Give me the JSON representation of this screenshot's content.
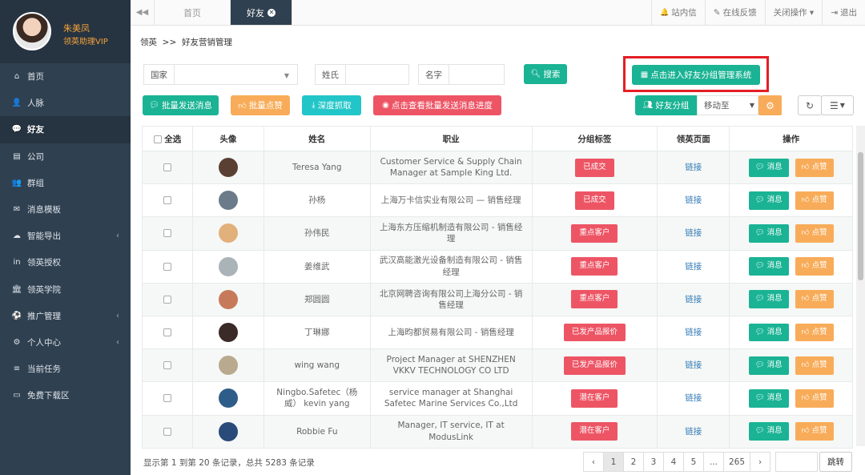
{
  "profile": {
    "name": "朱美凤",
    "role": "领英助理VIP"
  },
  "sidebar": {
    "items": [
      {
        "label": "首页",
        "icon": "home-icon",
        "glyph": "⌂"
      },
      {
        "label": "人脉",
        "icon": "user-icon",
        "glyph": "👤"
      },
      {
        "label": "好友",
        "icon": "comments-icon",
        "glyph": "💬",
        "active": true
      },
      {
        "label": "公司",
        "icon": "briefcase-icon",
        "glyph": "▤"
      },
      {
        "label": "群组",
        "icon": "users-icon",
        "glyph": "👥"
      },
      {
        "label": "消息模板",
        "icon": "envelope-icon",
        "glyph": "✉"
      },
      {
        "label": "智能导出",
        "icon": "cloud-download-icon",
        "glyph": "☁",
        "arrow": "‹"
      },
      {
        "label": "领英授权",
        "icon": "linkedin-icon",
        "glyph": "in"
      },
      {
        "label": "领英学院",
        "icon": "bank-icon",
        "glyph": "🏛"
      },
      {
        "label": "推广管理",
        "icon": "soccer-icon",
        "glyph": "⚽",
        "arrow": "‹"
      },
      {
        "label": "个人中心",
        "icon": "cog-icon",
        "glyph": "⚙",
        "arrow": "‹"
      },
      {
        "label": "当前任务",
        "icon": "tasks-icon",
        "glyph": "≡"
      },
      {
        "label": "免费下载区",
        "icon": "credit-card-icon",
        "glyph": "▭"
      }
    ]
  },
  "topbar": {
    "tabs": [
      {
        "label": "首页"
      },
      {
        "label": "好友"
      }
    ],
    "links": [
      {
        "label": "站内信",
        "glyph": "🔔"
      },
      {
        "label": "在线反馈",
        "glyph": "✎"
      },
      {
        "label": "关闭操作 ▾"
      },
      {
        "label": "退出",
        "glyph": "⇥"
      }
    ]
  },
  "breadcrumb": "领英  >>  好友营销管理",
  "filters": {
    "country_label": "国家",
    "surname_label": "姓氏",
    "name_label": "名字",
    "search_label": "搜索"
  },
  "actions": {
    "enter_group_system": "点击进入好友分组管理系统",
    "batch_send": "批量发送消息",
    "batch_like": "批量点赞",
    "deep_crawl": "深度抓取",
    "view_progress": "点击查看批量发送消息进度",
    "friend_group": "好友分组",
    "move_to": "移动至"
  },
  "table": {
    "headers": {
      "select_all": "全选",
      "avatar": "头像",
      "name": "姓名",
      "job": "职业",
      "group_tag": "分组标签",
      "linkedin_page": "领英页面",
      "ops": "操作"
    },
    "link_label": "链接",
    "msg_label": "消息",
    "like_label": "点赞",
    "rows": [
      {
        "name": "Teresa Yang",
        "job": "Customer Service & Supply Chain Manager at Sample King Ltd.",
        "tag": "已成交",
        "avatar_color": "#5a4033"
      },
      {
        "name": "孙杨",
        "job": "上海万卡信实业有限公司 — 销售经理",
        "tag": "已成交",
        "avatar_color": "#6b7b8a"
      },
      {
        "name": "孙伟民",
        "job": "上海东方压缩机制造有限公司 - 销售经理",
        "tag": "重点客户",
        "avatar_color": "#e2b07a"
      },
      {
        "name": "姜维武",
        "job": "武汉高能激光设备制造有限公司 - 销售经理",
        "tag": "重点客户",
        "avatar_color": "#a9b3b8"
      },
      {
        "name": "郑圆圆",
        "job": "北京网聘咨询有限公司上海分公司 - 销售经理",
        "tag": "重点客户",
        "avatar_color": "#c77a5a"
      },
      {
        "name": "丁琳娜",
        "job": "上海昀都贸易有限公司 - 销售经理",
        "tag": "已发产品报价",
        "avatar_color": "#3a2a28"
      },
      {
        "name": "wing wang",
        "job": "Project Manager at SHENZHEN VKKV TECHNOLOGY CO LTD",
        "tag": "已发产品报价",
        "avatar_color": "#b9a98e"
      },
      {
        "name": "Ningbo.Safetec（杨威） kevin yang",
        "job": "service manager at Shanghai Safetec Marine Services Co.,Ltd",
        "tag": "潜在客户",
        "avatar_color": "#2f5d8a"
      },
      {
        "name": "Robbie Fu",
        "job": "Manager, IT service, IT at ModusLink",
        "tag": "潜在客户",
        "avatar_color": "#2a4a7a"
      }
    ]
  },
  "footer": {
    "info": "显示第 1 到第 20 条记录，总共 5283 条记录",
    "pages": [
      "‹",
      "1",
      "2",
      "3",
      "4",
      "5",
      "...",
      "265",
      "›"
    ],
    "jump_label": "跳转"
  }
}
